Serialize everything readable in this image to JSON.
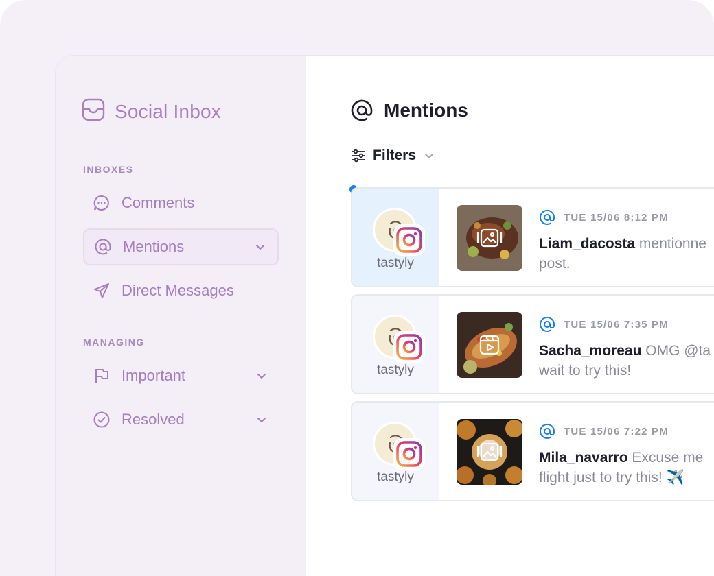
{
  "sidebar": {
    "brand_title": "Social Inbox",
    "sections": [
      {
        "label": "INBOXES"
      },
      {
        "label": "MANAGING"
      }
    ],
    "items": [
      {
        "label": "Comments",
        "icon": "chat-bubble-icon"
      },
      {
        "label": "Mentions",
        "icon": "at-icon",
        "active": true
      },
      {
        "label": "Direct Messages",
        "icon": "send-icon"
      },
      {
        "label": "Important",
        "icon": "flag-icon"
      },
      {
        "label": "Resolved",
        "icon": "check-circle-icon"
      }
    ]
  },
  "main": {
    "title": "Mentions",
    "filters_label": "Filters",
    "mentions": [
      {
        "account": "tastyly",
        "time": "TUE 15/06 8:12 PM",
        "user": "Liam_dacosta",
        "text_line1": " mentionne",
        "text_line2": "post.",
        "media": "image",
        "unread": true
      },
      {
        "account": "tastyly",
        "time": "TUE 15/06 7:35 PM",
        "user": "Sacha_moreau",
        "text_line1": " OMG @ta",
        "text_line2": "wait to try this!",
        "media": "video"
      },
      {
        "account": "tastyly",
        "time": "TUE 15/06 7:22 PM",
        "user": "Mila_navarro",
        "text_line1": " Excuse me",
        "text_line2": "flight just to try this! ✈️",
        "media": "image"
      }
    ]
  },
  "colors": {
    "accent": "#a67dc0",
    "mention_blue": "#1a7ff0",
    "unread_bg": "#e5f2fe"
  }
}
